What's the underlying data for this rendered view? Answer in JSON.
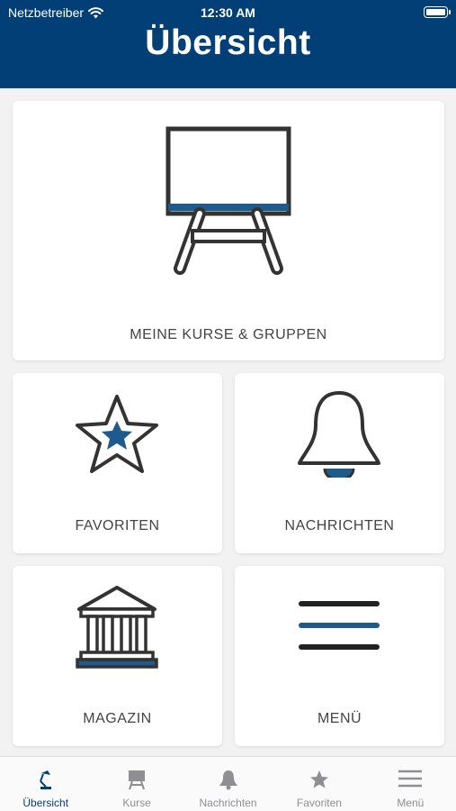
{
  "status_bar": {
    "carrier": "Netzbetreiber",
    "time": "12:30 AM"
  },
  "header": {
    "title": "Übersicht"
  },
  "tiles": {
    "kurse": "MEINE KURSE & GRUPPEN",
    "favoriten": "FAVORITEN",
    "nachrichten": "NACHRICHTEN",
    "magazin": "MAGAZIN",
    "menu": "MENÜ"
  },
  "tabbar": {
    "items": [
      {
        "label": "Übersicht",
        "icon": "desk-lamp-icon",
        "active": true
      },
      {
        "label": "Kurse",
        "icon": "easel-icon",
        "active": false
      },
      {
        "label": "Nachrichten",
        "icon": "bell-icon",
        "active": false
      },
      {
        "label": "Favoriten",
        "icon": "star-icon",
        "active": false
      },
      {
        "label": "Menü",
        "icon": "menu-icon",
        "active": false
      }
    ]
  },
  "colors": {
    "brand": "#033f77",
    "accent": "#1f5a8c",
    "icon_dark": "#333333",
    "inactive": "#8e8e93"
  }
}
